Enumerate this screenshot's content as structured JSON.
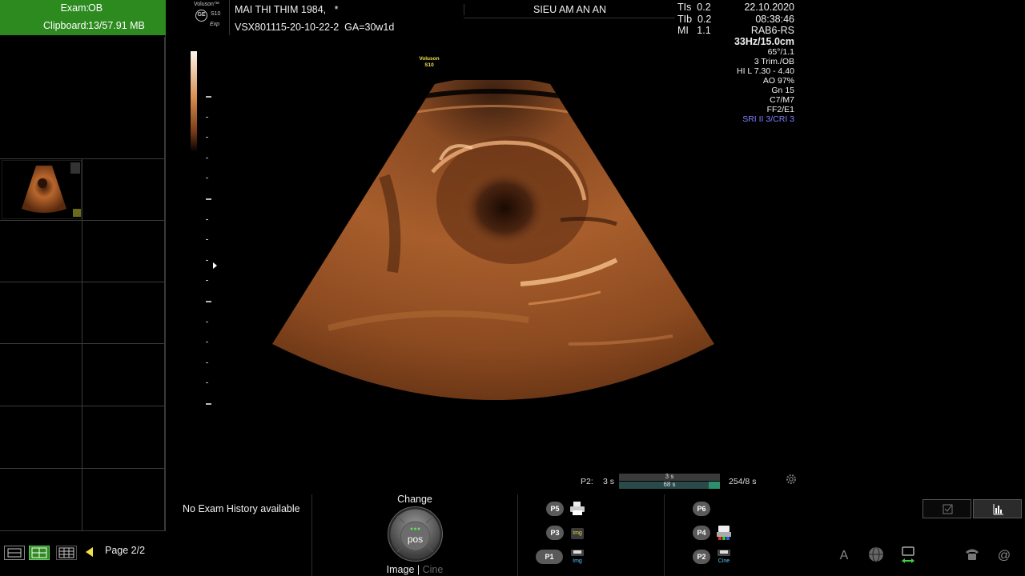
{
  "exam_panel": {
    "exam_label": "Exam:",
    "exam_value": "OB",
    "clipboard_label": "Clipboard:",
    "clipboard_value": "13/57.91 MB"
  },
  "header": {
    "brand": "Voluson™",
    "brand_logo": "GE",
    "model": "S10",
    "model_suffix": "Exp",
    "patient_name": "MAI THI THIM 1984,",
    "patient_flag": "*",
    "patient_id": "VSX801115-20-10-22-2",
    "gestational_age": "GA=30w1d",
    "hospital": "SIEU AM AN AN",
    "indices": [
      "TIs  0.2",
      "TIb  0.2",
      "MI   1.1"
    ],
    "date": "22.10.2020",
    "time": "08:38:46",
    "probe": "RAB6-RS"
  },
  "scan_params": {
    "frame_depth": "33Hz/15.0cm",
    "angle": "65°/1.1",
    "preset": "3 Trim./OB",
    "frequency": "HI L  7.30 - 4.40",
    "ao": "AO 97%",
    "gain": "Gn  15",
    "c_m": "C7/M7",
    "ff_e": "FF2/E1",
    "sri_cri": "SRI II 3/CRI 3",
    "sri_color": "#7f7fff"
  },
  "image": {
    "probe_label_line1": "Voluson",
    "probe_label_line2": "S10",
    "grayscale_colors": [
      "#fff7ea",
      "#d88f52",
      "#7a3a16",
      "#000000"
    ]
  },
  "cine": {
    "preset_label": "P2:",
    "duration": "3 s",
    "bar_top": "3 s",
    "bar_bottom": "68 s",
    "frames": "254/8 s",
    "settings_icon": "gear-icon"
  },
  "bottom": {
    "exam_history": "No Exam History available",
    "change_label": "Change",
    "knob_label": "pos",
    "mode_image": "Image",
    "mode_separator": "|",
    "mode_cine": "Cine",
    "p_buttons": {
      "p5": "P5",
      "p3": "P3",
      "p1": "P1",
      "p6": "P6",
      "p4": "P4",
      "p2": "P2"
    },
    "icon_labels": {
      "img": "Img",
      "cine": "Cine"
    },
    "page_label": "Page 2/2"
  },
  "system_icons": [
    "font-icon",
    "globe-icon",
    "network-icon",
    "phone-icon",
    "at-icon"
  ],
  "colors": {
    "exam_box": "#2d8a1f",
    "accent_yellow": "#f2e24c",
    "tissue": "#b8662c"
  }
}
